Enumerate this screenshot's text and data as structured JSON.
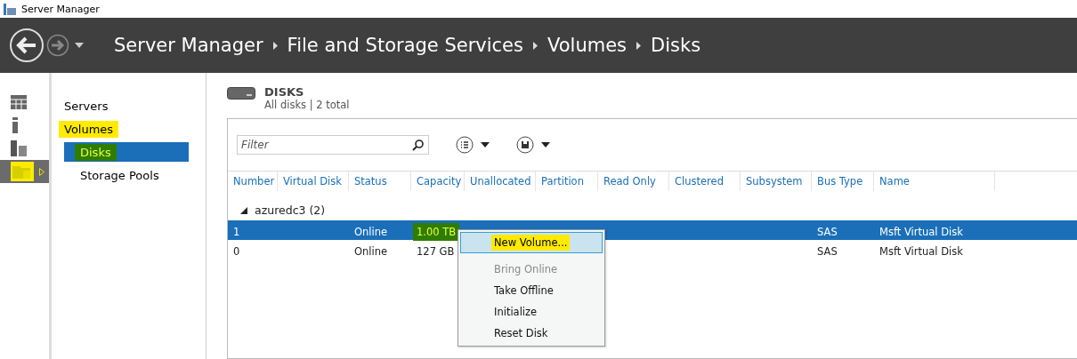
{
  "window": {
    "title": "Server Manager"
  },
  "breadcrumb": [
    "Server Manager",
    "File and Storage Services",
    "Volumes",
    "Disks"
  ],
  "rail": [
    {
      "kind": "grid",
      "selected": false
    },
    {
      "kind": "single",
      "selected": false
    },
    {
      "kind": "split",
      "selected": false
    },
    {
      "kind": "folder",
      "selected": true,
      "color": "#ffeb00"
    }
  ],
  "nav": [
    {
      "label": "Servers",
      "selected": false
    },
    {
      "label": "Volumes",
      "selected": false,
      "color": "#ffeb00",
      "children": [
        {
          "label": "Disks",
          "selected": true,
          "color": "#2e7d00"
        },
        {
          "label": "Storage Pools",
          "selected": false
        }
      ]
    }
  ],
  "section": {
    "title": "DISKS",
    "subtitle": "All disks | 2 total"
  },
  "filter": {
    "placeholder": "Filter"
  },
  "table": {
    "columns": [
      "Number",
      "Virtual Disk",
      "Status",
      "Capacity",
      "Unallocated",
      "Partition",
      "Read Only",
      "Clustered",
      "Subsystem",
      "Bus Type",
      "Name"
    ],
    "group": {
      "label": "azuredc3 (2)",
      "expanded": true
    },
    "rows": [
      {
        "selected": true,
        "cells": [
          {
            "text": "1"
          },
          {
            "text": ""
          },
          {
            "text": "Online"
          },
          {
            "text": "1.00 TB",
            "color": "#2e7d00"
          },
          {
            "text": ""
          },
          {
            "text": ""
          },
          {
            "text": ""
          },
          {
            "text": ""
          },
          {
            "text": ""
          },
          {
            "text": "SAS"
          },
          {
            "text": "Msft Virtual Disk"
          }
        ]
      },
      {
        "selected": false,
        "cells": [
          {
            "text": "0"
          },
          {
            "text": ""
          },
          {
            "text": "Online"
          },
          {
            "text": "127 GB"
          },
          {
            "text": ""
          },
          {
            "text": ""
          },
          {
            "text": ""
          },
          {
            "text": ""
          },
          {
            "text": ""
          },
          {
            "text": "SAS"
          },
          {
            "text": "Msft Virtual Disk"
          }
        ]
      }
    ]
  },
  "context_menu": [
    {
      "label": "New Volume...",
      "selected": true,
      "disabled": false,
      "color": "#ffeb00"
    },
    {
      "label": "Bring Online",
      "selected": false,
      "disabled": true
    },
    {
      "label": "Take Offline",
      "selected": false,
      "disabled": false
    },
    {
      "label": "Initialize",
      "selected": false,
      "disabled": false
    },
    {
      "label": "Reset Disk",
      "selected": false,
      "disabled": false
    }
  ]
}
